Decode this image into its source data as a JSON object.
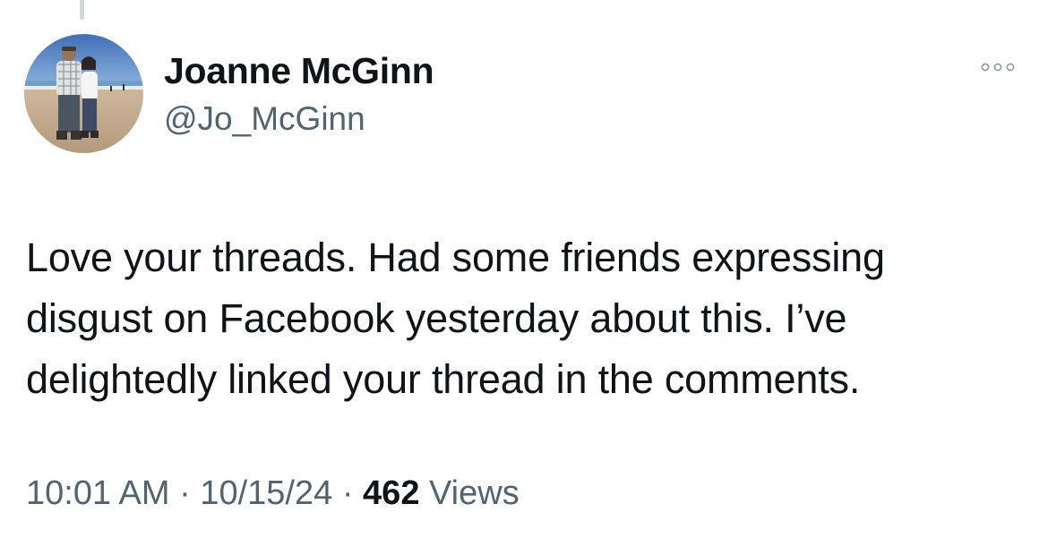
{
  "author": {
    "name": "Joanne McGinn",
    "handle": "@Jo_McGinn"
  },
  "tweet": {
    "text_lines": [
      "Love your threads. Had some friends expressing",
      "disgust on Facebook yesterday about this. I’ve",
      "delightedly linked your thread in the comments."
    ]
  },
  "meta": {
    "time": "10:01 AM",
    "separator": "·",
    "date": "10/15/24",
    "views_count": "462",
    "views_label": "Views"
  },
  "icons": {
    "more": "more-horizontal-icon",
    "avatar": "profile-photo"
  },
  "colors": {
    "text_primary": "#0f1419",
    "text_secondary": "#536471",
    "thread_line": "#cfd9de"
  }
}
